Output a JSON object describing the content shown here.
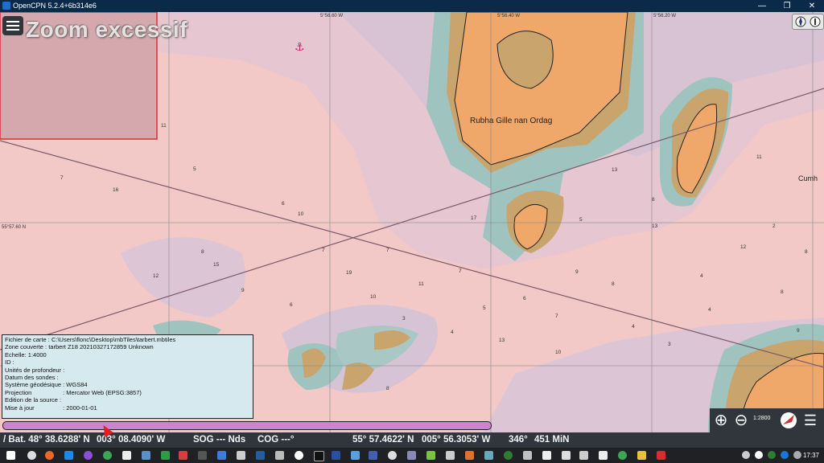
{
  "window": {
    "title": "OpenCPN 5.2.4+6b314e6",
    "minimize_glyph": "—",
    "maximize_glyph": "❐",
    "close_glyph": "✕"
  },
  "overlay": {
    "zoom_message": "Zoom excessif"
  },
  "chart": {
    "place_name": "Rubha Gille nan Ordag",
    "edge_label": "Cumh",
    "grid_labels": {
      "lon1": "5°56.60 W",
      "lon2": "5°56.40 W",
      "lon3": "5°56.20 W",
      "lat1": "55°57.60 N"
    },
    "soundings": [
      "11",
      "7",
      "16",
      "10",
      "19",
      "15",
      "10",
      "3",
      "6",
      "7",
      "8",
      "5",
      "17",
      "5",
      "7",
      "13",
      "8",
      "4",
      "11",
      "9",
      "9",
      "13",
      "8",
      "12",
      "4",
      "6",
      "12",
      "8",
      "11",
      "6",
      "2",
      "5",
      "8",
      "4",
      "7",
      "7",
      "9",
      "13",
      "10",
      "3",
      "4",
      "8"
    ]
  },
  "info_panel": {
    "rows": [
      {
        "label": "Fichier de carte :",
        "value": "C:\\Users\\flonc\\Desktop\\mbTiles\\tarbert.mbtiles"
      },
      {
        "label": "Zone couverte :",
        "value": "tarbert Z18 20210327172859 Unknown"
      },
      {
        "label": "Echelle:",
        "value": "1:4000"
      },
      {
        "label": "ID",
        "value": ":"
      },
      {
        "label": "Unités de profondeur",
        "value": ":"
      },
      {
        "label": "Datum des sondes",
        "value": ":"
      },
      {
        "label": "Système géodésique :",
        "value": "WGS84"
      },
      {
        "label": "Projection",
        "value": ": Mercator Web (EPSG:3857)"
      },
      {
        "label": "Edition de la source",
        "value": ":"
      },
      {
        "label": "Mise à jour",
        "value": ": 2000-01-01"
      }
    ]
  },
  "tools": {
    "zoom_in": "⊕",
    "zoom_out": "⊖",
    "scale": "1:2800",
    "menu_glyph": "☰"
  },
  "status_bar": {
    "bat_lat": "/ Bat. 48° 38.6288' N",
    "bat_lon": "003° 08.4090' W",
    "sog": "SOG --- Nds",
    "cog": "COG ---°",
    "cursor_lat": "55° 57.4622' N",
    "cursor_lon": "005° 56.3053' W",
    "bearing": "346°",
    "distance": "451 MiN"
  },
  "taskbar": {
    "clock": "17:37"
  }
}
